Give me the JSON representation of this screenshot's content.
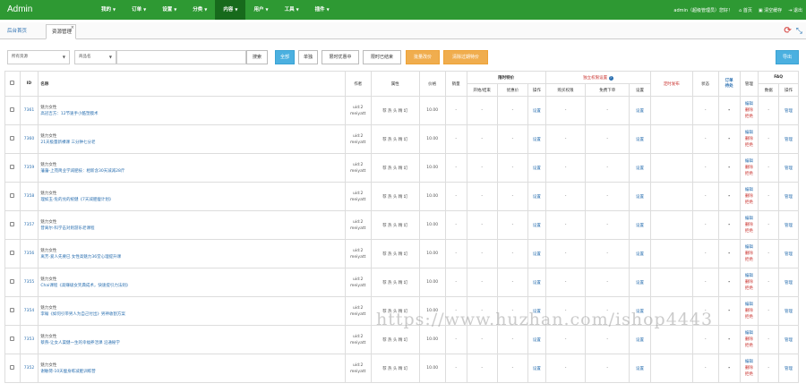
{
  "app": {
    "brand": "Admin"
  },
  "nav": [
    {
      "label": "我的",
      "active": false
    },
    {
      "label": "订单",
      "active": false
    },
    {
      "label": "设置",
      "active": false
    },
    {
      "label": "分类",
      "active": false
    },
    {
      "label": "内容",
      "active": true
    },
    {
      "label": "用户",
      "active": false
    },
    {
      "label": "工具",
      "active": false
    },
    {
      "label": "插件",
      "active": false
    }
  ],
  "user": {
    "greeting": "admin（超级管理员）您好！",
    "home": "首页",
    "clear_cache": "清空缓存",
    "logout": "退出"
  },
  "tabs": [
    {
      "label": "后台首页"
    },
    {
      "label": "资源管理"
    }
  ],
  "tab_close": "×",
  "filter": {
    "select1": "所有资源",
    "select2": "商品名",
    "search_btn": "搜索",
    "all_btn": "全部",
    "single_btn": "单独",
    "timed_btn": "限时优惠中",
    "timed_end_btn": "限时已结束",
    "batch_price_btn": "批量改价",
    "clear_price_btn": "清除过期特价",
    "export_btn": "导出"
  },
  "table": {
    "groups": {
      "limited": "限时特价",
      "exclusive": "独立权限设置",
      "custom": "定时发布",
      "faq": "FAQ"
    },
    "headers": {
      "id": "ID",
      "name": "名称",
      "author": "作者",
      "attr": "属性",
      "price": "价格",
      "sales": "销量",
      "time": "开始/结束",
      "discount": "优惠价",
      "op": "操作",
      "buy_perm": "购买权限",
      "free_dl": "免费下单",
      "set": "设置",
      "status": "状态",
      "order_review": "订单\n待处",
      "manage": "管理",
      "faq_count": "数据",
      "faq_op": "操作"
    },
    "rows": [
      {
        "id": "7361",
        "cat": "魅力女性",
        "title": "高冠吉方：12节速手小酷塑膜术",
        "author1": "uid:2",
        "author2": "meiyatt",
        "attrs": "荐 热 头 精 幻",
        "price": "10.00",
        "sales": "-",
        "time": "-",
        "discount": "-",
        "op": "设置",
        "buy": "-",
        "free": "-",
        "set": "设置",
        "status": "-",
        "review": "-",
        "m1": "编辑",
        "m2": "删除",
        "m3": "拒绝",
        "faq": "-",
        "faq_op": "管理"
      },
      {
        "id": "7360",
        "cat": "魅力女性",
        "title": "21天极量新裸课 三分钟七分老",
        "author1": "uid:2",
        "author2": "meiyatt",
        "attrs": "荐 热 头 精 幻",
        "price": "10.00",
        "sales": "-",
        "time": "-",
        "discount": "-",
        "op": "设置",
        "buy": "-",
        "free": "-",
        "set": "设置",
        "status": "-",
        "review": "-",
        "m1": "编辑",
        "m2": "删除",
        "m3": "拒绝",
        "faq": "-",
        "faq_op": "管理"
      },
      {
        "id": "7359",
        "cat": "魅力女性",
        "title": "藩藩-上苑简业学减肥技：相新含30天减减28斤",
        "author1": "uid:2",
        "author2": "meiyatt",
        "attrs": "荐 热 头 精 幻",
        "price": "10.00",
        "sales": "-",
        "time": "-",
        "discount": "-",
        "op": "设置",
        "buy": "-",
        "free": "-",
        "set": "设置",
        "status": "-",
        "review": "-",
        "m1": "编辑",
        "m2": "删除",
        "m3": "拒绝",
        "faq": "-",
        "faq_op": "管理"
      },
      {
        "id": "7358",
        "cat": "魅力女性",
        "title": "理如玉-危的兑的统健《7天减肥瘦计划》",
        "author1": "uid:2",
        "author2": "meiyatt",
        "attrs": "荐 热 头 精 幻",
        "price": "10.00",
        "sales": "-",
        "time": "-",
        "discount": "-",
        "op": "设置",
        "buy": "-",
        "free": "-",
        "set": "设置",
        "status": "-",
        "review": "-",
        "m1": "编辑",
        "m2": "删除",
        "m3": "拒绝",
        "faq": "-",
        "faq_op": "管理"
      },
      {
        "id": "7357",
        "cat": "魅力女性",
        "title": "昔离尔-科学击对则游乐老课程",
        "author1": "uid:2",
        "author2": "meiyatt",
        "attrs": "荐 热 头 精 幻",
        "price": "10.00",
        "sales": "-",
        "time": "-",
        "discount": "-",
        "op": "设置",
        "buy": "-",
        "free": "-",
        "set": "设置",
        "status": "-",
        "review": "-",
        "m1": "编辑",
        "m2": "删除",
        "m3": "拒绝",
        "faq": "-",
        "faq_op": "管理"
      },
      {
        "id": "7356",
        "cat": "魅力女性",
        "title": "离芳-爱人先要已 女性高魅力36堂心理提升课",
        "author1": "uid:2",
        "author2": "meiyatt",
        "attrs": "荐 热 头 精 幻",
        "price": "10.00",
        "sales": "-",
        "time": "-",
        "discount": "-",
        "op": "设置",
        "buy": "-",
        "free": "-",
        "set": "设置",
        "status": "-",
        "review": "-",
        "m1": "编辑",
        "m2": "删除",
        "m3": "拒绝",
        "faq": "-",
        "faq_op": "管理"
      },
      {
        "id": "7355",
        "cat": "魅力女性",
        "title": "Chai课程《高赚级女笑典成术，快速提引力法则》",
        "author1": "uid:2",
        "author2": "meiyatt",
        "attrs": "荐 热 头 精 幻",
        "price": "10.00",
        "sales": "-",
        "time": "-",
        "discount": "-",
        "op": "设置",
        "buy": "-",
        "free": "-",
        "set": "设置",
        "status": "-",
        "review": "-",
        "m1": "编辑",
        "m2": "删除",
        "m3": "拒绝",
        "faq": "-",
        "faq_op": "管理"
      },
      {
        "id": "7354",
        "cat": "魅力女性",
        "title": "李翰《如何引带男人为自己付出》男神收割方案",
        "author1": "uid:2",
        "author2": "meiyatt",
        "attrs": "荐 热 头 精 幻",
        "price": "10.00",
        "sales": "-",
        "time": "-",
        "discount": "-",
        "op": "设置",
        "buy": "-",
        "free": "-",
        "set": "设置",
        "status": "-",
        "review": "-",
        "m1": "编辑",
        "m2": "删除",
        "m3": "拒绝",
        "faq": "-",
        "faq_op": "管理"
      },
      {
        "id": "7353",
        "cat": "魅力女性",
        "title": "蔡燕-让女人渠健一生的幸福养活课 沿通秘学",
        "author1": "uid:2",
        "author2": "meiyatt",
        "attrs": "荐 热 头 精 幻",
        "price": "10.00",
        "sales": "-",
        "time": "-",
        "discount": "-",
        "op": "设置",
        "buy": "-",
        "free": "-",
        "set": "设置",
        "status": "-",
        "review": "-",
        "m1": "编辑",
        "m2": "删除",
        "m3": "拒绝",
        "faq": "-",
        "faq_op": "管理"
      },
      {
        "id": "7352",
        "cat": "魅力女性",
        "title": "谢敏荷-10天瘦身练减肥训练营",
        "author1": "uid:2",
        "author2": "meiyatt",
        "attrs": "荐 热 头 精 幻",
        "price": "10.00",
        "sales": "-",
        "time": "-",
        "discount": "-",
        "op": "设置",
        "buy": "-",
        "free": "-",
        "set": "设置",
        "status": "-",
        "review": "-",
        "m1": "编辑",
        "m2": "删除",
        "m3": "拒绝",
        "faq": "-",
        "faq_op": "管理"
      }
    ]
  },
  "watermark": "https://www.huzhan.com/ishop4443"
}
